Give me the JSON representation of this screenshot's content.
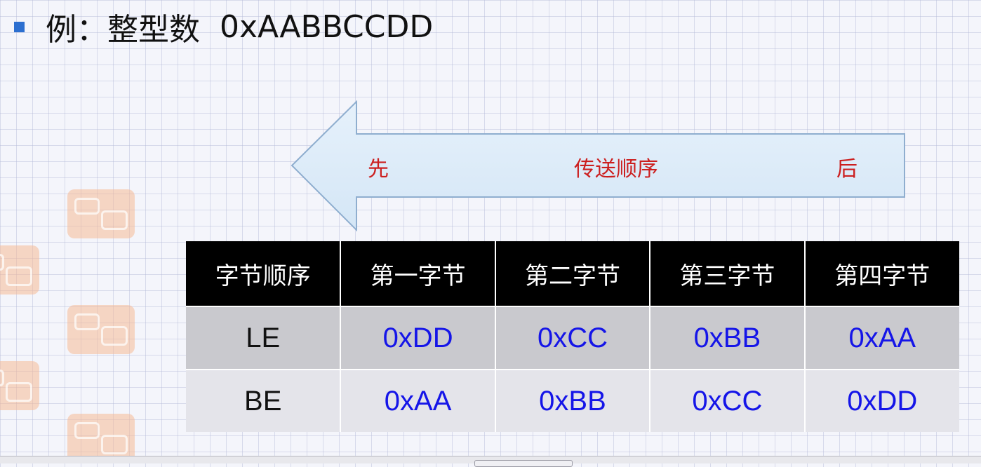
{
  "heading": {
    "prefix": "例：",
    "title": "整型数",
    "value": "0xAABBCCDD"
  },
  "arrow": {
    "first": "先",
    "middle": "传送顺序",
    "last": "后"
  },
  "table": {
    "headers": [
      "字节顺序",
      "第一字节",
      "第二字节",
      "第三字节",
      "第四字节"
    ],
    "rows": [
      {
        "label": "LE",
        "values": [
          "0xDD",
          "0xCC",
          "0xBB",
          "0xAA"
        ]
      },
      {
        "label": "BE",
        "values": [
          "0xAA",
          "0xBB",
          "0xCC",
          "0xDD"
        ]
      }
    ]
  },
  "colors": {
    "accent": "#2c6fd0",
    "arrow_fill": "#dcebf8",
    "arrow_text": "#cc1f1f",
    "value_text": "#1515e8"
  }
}
